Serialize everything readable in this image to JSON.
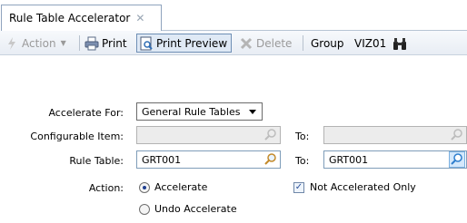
{
  "tab": {
    "title": "Rule Table Accelerator",
    "close_icon": "close-icon"
  },
  "toolbar": {
    "action_label": "Action",
    "print_label": "Print",
    "print_preview_label": "Print Preview",
    "delete_label": "Delete",
    "group_label": "Group",
    "group_value": "VIZ01"
  },
  "form": {
    "accelerate_for": {
      "label": "Accelerate For:",
      "value": "General Rule Tables"
    },
    "configurable_item": {
      "label": "Configurable Item:",
      "from_value": "",
      "to_label": "To:",
      "to_value": ""
    },
    "rule_table": {
      "label": "Rule Table:",
      "from_value": "GRT001",
      "to_label": "To:",
      "to_value": "GRT001"
    },
    "action": {
      "label": "Action:",
      "options": [
        {
          "label": "Accelerate",
          "selected": true
        },
        {
          "label": "Undo Accelerate",
          "selected": false
        }
      ],
      "not_accelerated_only": {
        "label": "Not Accelerated Only",
        "checked": true
      }
    }
  },
  "colors": {
    "accent_border": "#7f9db9",
    "disabled_bg": "#ececec",
    "toolbar_bg": "#e8edf4"
  }
}
